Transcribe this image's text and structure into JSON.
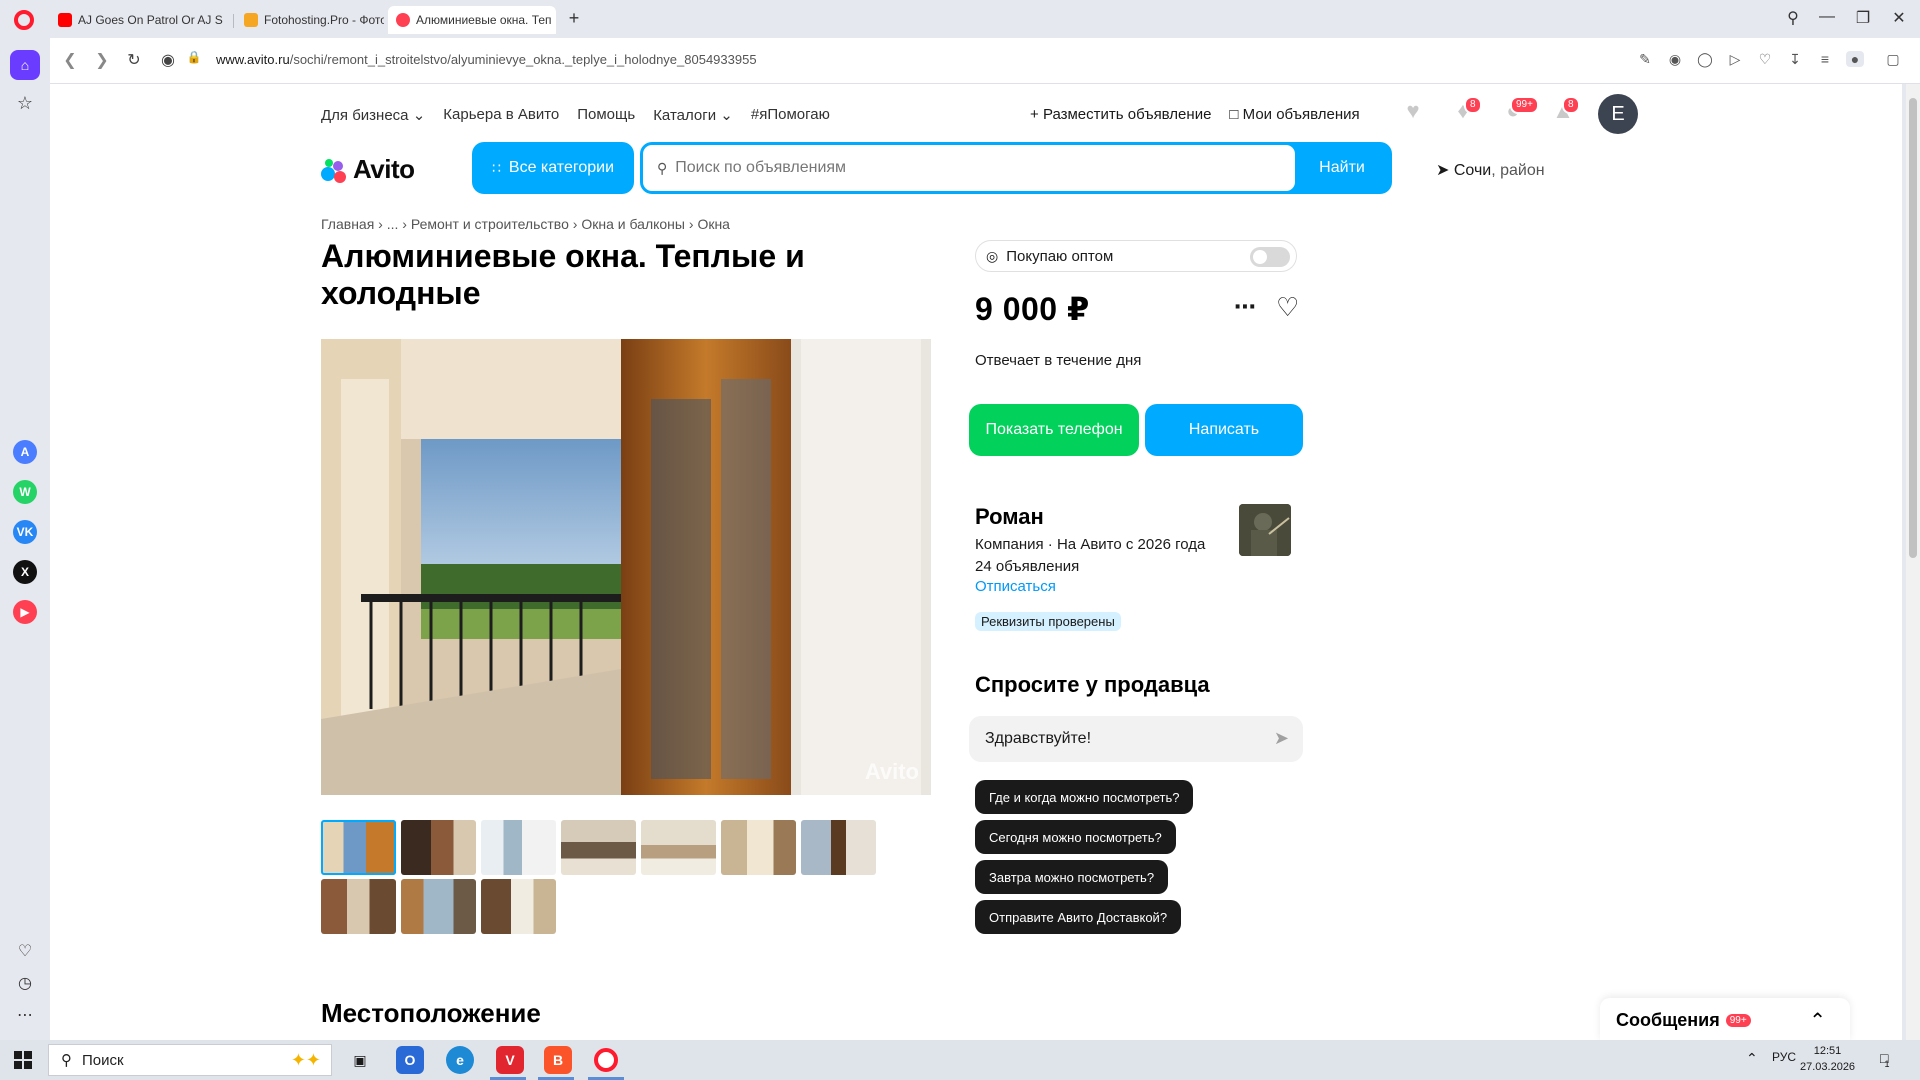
{
  "browser": {
    "tabs": [
      {
        "title": "AJ Goes On Patrol Or AJ S",
        "favicon_color": "#ff0000"
      },
      {
        "title": "Fotohosting.Pro - Фотохо",
        "favicon_color": "#f5a623"
      },
      {
        "title": "Алюминиевые окна. Теп",
        "favicon_color": "#ff4053"
      }
    ],
    "url_domain": "www.avito.ru",
    "url_path": "/sochi/remont_i_stroitelstvo/alyuminievye_okna._teplye_i_holodnye_8054933955"
  },
  "header": {
    "top_links": [
      "Для бизнеса",
      "Карьера в Авито",
      "Помощь",
      "Каталоги",
      "#яПомогаю"
    ],
    "post_ad": "Разместить объявление",
    "my_ads": "Мои объявления",
    "notifications_count": "8",
    "messages_count": "99+",
    "cart_count": "8",
    "avatar_letter": "E",
    "logo": "Avito",
    "all_categories": "Все категории",
    "search_placeholder": "Поиск по объявлениям",
    "search_button": "Найти",
    "location_city": "Сочи",
    "location_suffix": ", район"
  },
  "breadcrumb": [
    "Главная",
    "...",
    "Ремонт и строительство",
    "Окна и балконы",
    "Окна"
  ],
  "listing": {
    "title": "Алюминиевые окна. Теплые и холодные",
    "watermark": "Avito",
    "thumbnail_count": 10,
    "location_heading": "Местоположение"
  },
  "sidebar": {
    "wholesale_label": "Покупаю оптом",
    "wholesale_enabled": false,
    "price": "9 000 ₽",
    "response_time": "Отвечает в течение дня",
    "show_phone": "Показать телефон",
    "write": "Написать",
    "seller_name": "Роман",
    "seller_type": "Компания · На Авито с 2026 года",
    "seller_ads": "24 объявления",
    "unsubscribe": "Отписаться",
    "verified": "Реквизиты проверены",
    "ask_heading": "Спросите у продавца",
    "message_value": "Здравствуйте!",
    "quick_questions": [
      "Где и когда можно посмотреть?",
      "Сегодня можно посмотреть?",
      "Завтра можно посмотреть?",
      "Отправите Авито Доставкой?"
    ]
  },
  "messages_panel": {
    "label": "Сообщения",
    "count": "99+"
  },
  "taskbar": {
    "search_placeholder": "Поиск",
    "language": "РУС",
    "time": "12:51",
    "date": "27.03.2026",
    "notification_count": "1"
  }
}
